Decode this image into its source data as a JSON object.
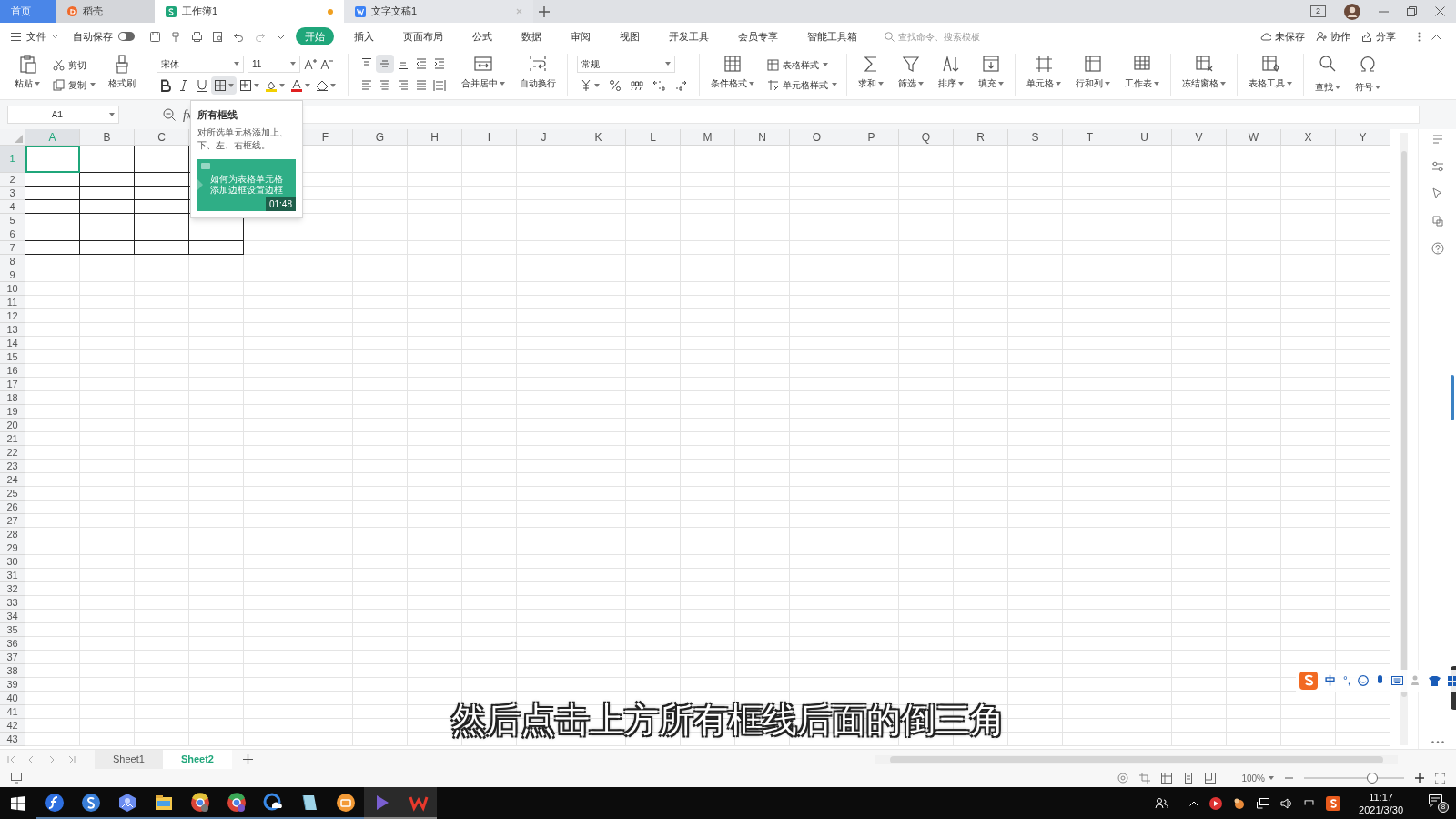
{
  "title_tabs": [
    {
      "label": "首页",
      "kind": "home",
      "selected": false
    },
    {
      "label": "稻壳",
      "kind": "docer",
      "selected": false
    },
    {
      "label": "工作簿1",
      "kind": "sheet",
      "selected": true,
      "modified": true
    },
    {
      "label": "文字文稿1",
      "kind": "writer",
      "selected": false,
      "modified": false
    }
  ],
  "window_controls": {
    "badge": "2"
  },
  "menu": {
    "file": "文件",
    "autosave": {
      "label": "自动保存",
      "on": false
    },
    "tabs": [
      {
        "label": "开始",
        "selected": true
      },
      {
        "label": "插入",
        "selected": false
      },
      {
        "label": "页面布局",
        "selected": false
      },
      {
        "label": "公式",
        "selected": false
      },
      {
        "label": "数据",
        "selected": false
      },
      {
        "label": "审阅",
        "selected": false
      },
      {
        "label": "视图",
        "selected": false
      },
      {
        "label": "开发工具",
        "selected": false
      },
      {
        "label": "会员专享",
        "selected": false
      },
      {
        "label": "智能工具箱",
        "selected": false
      }
    ],
    "search": {
      "placeholder": "查找命令、搜索模板"
    },
    "actions": [
      "未保存",
      "协作",
      "分享"
    ]
  },
  "ribbon": [
    [
      {
        "kind": "large",
        "label": "粘贴",
        "caret": true
      },
      {
        "kind": "pair",
        "items": [
          {
            "label": "剪切",
            "caret": false
          },
          {
            "label": "复制",
            "caret": true
          }
        ]
      },
      {
        "kind": "large",
        "label": "格式刷",
        "caret": false
      }
    ],
    [
      {
        "kind": "font",
        "font": "宋体",
        "size": "11",
        "buttons": [
          {
            "selected": false
          },
          {
            "selected": false
          },
          {
            "selected": false
          },
          {
            "selected": true
          },
          {
            "selected": false
          },
          {
            "selected": false
          },
          {
            "selected": false
          },
          {
            "selected": false
          }
        ]
      }
    ],
    [
      {
        "kind": "align",
        "buttons": [
          {
            "selected": false
          },
          {
            "selected": true
          },
          {
            "selected": false
          },
          {
            "selected": false
          },
          {
            "selected": false
          },
          {
            "selected": false
          },
          {
            "selected": false
          },
          {
            "selected": false
          },
          {
            "selected": false
          },
          {
            "selected": false
          }
        ]
      },
      {
        "kind": "large",
        "label": "合并居中",
        "caret": true
      },
      {
        "kind": "large",
        "label": "自动换行",
        "caret": false
      }
    ],
    [
      {
        "kind": "number",
        "format": "常规"
      }
    ],
    [
      {
        "kind": "large",
        "label": "条件格式",
        "caret": true
      },
      {
        "kind": "pair",
        "items": [
          {
            "label": "表格样式",
            "caret": true
          },
          {
            "label": "单元格样式",
            "caret": true
          }
        ]
      }
    ],
    [
      {
        "kind": "large",
        "label": "求和",
        "caret": true
      },
      {
        "kind": "large",
        "label": "筛选",
        "caret": true
      },
      {
        "kind": "large",
        "label": "排序",
        "caret": true
      },
      {
        "kind": "large",
        "label": "填充",
        "caret": true
      }
    ],
    [
      {
        "kind": "large",
        "label": "单元格",
        "caret": true
      },
      {
        "kind": "large",
        "label": "行和列",
        "caret": true
      },
      {
        "kind": "large",
        "label": "工作表",
        "caret": true
      }
    ],
    [
      {
        "kind": "large",
        "label": "冻结窗格",
        "caret": true
      }
    ],
    [
      {
        "kind": "large",
        "label": "表格工具",
        "caret": true
      }
    ],
    [
      {
        "kind": "large",
        "label": "查找",
        "caret": true
      },
      {
        "kind": "large",
        "label": "符号",
        "caret": true
      }
    ]
  ],
  "name_box": "A1",
  "formula_label": "fx",
  "tooltip": {
    "title": "所有框线",
    "description": "对所选单元格添加上、下、左、右框线。",
    "video": {
      "caption": [
        "如何为表格单元格",
        "添加边框设置边框"
      ],
      "duration": "01:48"
    }
  },
  "columns": [
    {
      "label": "A",
      "selected": true,
      "bordered": true
    },
    {
      "label": "B",
      "selected": false,
      "bordered": true
    },
    {
      "label": "C",
      "selected": false,
      "bordered": true
    },
    {
      "bordered": true
    },
    {
      "bordered": false
    },
    {
      "label": "F",
      "selected": false,
      "bordered": false
    },
    {
      "label": "G",
      "selected": false,
      "bordered": false
    },
    {
      "label": "H",
      "selected": false,
      "bordered": false
    },
    {
      "label": "I",
      "selected": false,
      "bordered": false
    },
    {
      "label": "J",
      "selected": false,
      "bordered": false
    },
    {
      "label": "K",
      "selected": false,
      "bordered": false
    },
    {
      "label": "L",
      "selected": false,
      "bordered": false
    },
    {
      "label": "M",
      "selected": false,
      "bordered": false
    },
    {
      "label": "N",
      "selected": false,
      "bordered": false
    },
    {
      "label": "O",
      "selected": false,
      "bordered": false
    },
    {
      "label": "P",
      "selected": false,
      "bordered": false
    },
    {
      "label": "Q",
      "selected": false,
      "bordered": false
    },
    {
      "label": "R",
      "selected": false,
      "bordered": false
    },
    {
      "label": "S",
      "selected": false,
      "bordered": false
    },
    {
      "label": "T",
      "selected": false,
      "bordered": false
    },
    {
      "label": "U",
      "selected": false,
      "bordered": false
    },
    {
      "label": "V",
      "selected": false,
      "bordered": false
    },
    {
      "label": "W",
      "selected": false,
      "bordered": false
    },
    {
      "label": "X",
      "selected": false,
      "bordered": false
    },
    {
      "label": "Y",
      "selected": false,
      "bordered": false
    }
  ],
  "rows": [
    {
      "label": "1",
      "selected": true,
      "bordered": true
    },
    {
      "label": "2",
      "selected": false,
      "bordered": true
    },
    {
      "label": "3",
      "selected": false,
      "bordered": true
    },
    {
      "label": "4",
      "selected": false,
      "bordered": true
    },
    {
      "label": "5",
      "selected": false,
      "bordered": true
    },
    {
      "label": "6",
      "selected": false,
      "bordered": true
    },
    {
      "label": "7",
      "selected": false,
      "bordered": true
    },
    {
      "label": "8",
      "selected": false,
      "bordered": false
    },
    {
      "label": "9",
      "selected": false,
      "bordered": false
    },
    {
      "label": "10",
      "selected": false,
      "bordered": false
    },
    {
      "label": "11",
      "selected": false,
      "bordered": false
    },
    {
      "label": "12",
      "selected": false,
      "bordered": false
    },
    {
      "label": "13",
      "selected": false,
      "bordered": false
    },
    {
      "label": "14",
      "selected": false,
      "bordered": false
    },
    {
      "label": "15",
      "selected": false,
      "bordered": false
    },
    {
      "label": "16",
      "selected": false,
      "bordered": false
    },
    {
      "label": "17",
      "selected": false,
      "bordered": false
    },
    {
      "label": "18",
      "selected": false,
      "bordered": false
    },
    {
      "label": "19",
      "selected": false,
      "bordered": false
    },
    {
      "label": "20",
      "selected": false,
      "bordered": false
    },
    {
      "label": "21",
      "selected": false,
      "bordered": false
    },
    {
      "label": "22",
      "selected": false,
      "bordered": false
    },
    {
      "label": "23",
      "selected": false,
      "bordered": false
    },
    {
      "label": "24",
      "selected": false,
      "bordered": false
    },
    {
      "label": "25",
      "selected": false,
      "bordered": false
    },
    {
      "label": "26",
      "selected": false,
      "bordered": false
    },
    {
      "label": "27",
      "selected": false,
      "bordered": false
    },
    {
      "label": "28",
      "selected": false,
      "bordered": false
    },
    {
      "label": "29",
      "selected": false,
      "bordered": false
    },
    {
      "label": "30",
      "selected": false,
      "bordered": false
    },
    {
      "label": "31",
      "selected": false,
      "bordered": false
    },
    {
      "label": "32",
      "selected": false,
      "bordered": false
    },
    {
      "label": "33",
      "selected": false,
      "bordered": false
    },
    {
      "label": "34",
      "selected": false,
      "bordered": false
    },
    {
      "label": "35",
      "selected": false,
      "bordered": false
    },
    {
      "label": "36",
      "selected": false,
      "bordered": false
    },
    {
      "label": "37",
      "selected": false,
      "bordered": false
    },
    {
      "label": "38",
      "selected": false,
      "bordered": false
    },
    {
      "label": "39",
      "selected": false,
      "bordered": false
    },
    {
      "label": "40",
      "selected": false,
      "bordered": false
    },
    {
      "label": "41",
      "selected": false,
      "bordered": false
    },
    {
      "label": "42",
      "selected": false,
      "bordered": false
    },
    {
      "label": "43",
      "selected": false,
      "bordered": false
    }
  ],
  "sheets": [
    {
      "label": "Sheet1",
      "selected": false
    },
    {
      "label": "Sheet2",
      "selected": true
    }
  ],
  "status_bar": {
    "zoom": "100%",
    "zoom_slider": {
      "level": 0.7
    }
  },
  "subtitle": "然后点击上方所有框线后面的倒三角",
  "ime_bar": {
    "mode": "中",
    "punctuation": "°,"
  },
  "taskbar": {
    "ime": "中",
    "time": "11:17",
    "date": "2021/3/30",
    "notifications": "8"
  }
}
